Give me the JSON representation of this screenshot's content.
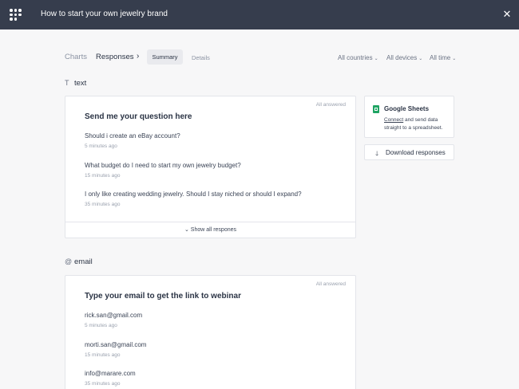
{
  "window": {
    "title": "How to start your own jewelry brand"
  },
  "nav": {
    "charts": "Charts",
    "responses": "Responses",
    "arrow": "›",
    "summary": "Summary",
    "details": "Details",
    "filters": {
      "countries": "All countries",
      "devices": "All devices",
      "time": "All time"
    }
  },
  "sections": [
    {
      "type_label": "text",
      "type_symbol": "T",
      "status": "All answered",
      "question": "Send me your question here",
      "responses": [
        {
          "text": "Should i create an eBay account?",
          "ago": "5 minutes ago"
        },
        {
          "text": "What budget do I need to start my own jewelry budget?",
          "ago": "15 minutes ago"
        },
        {
          "text": "I only like creating wedding jewelry. Should I stay niched or should I expand?",
          "ago": "35 minutes ago"
        }
      ],
      "show_all": "Show all respones"
    },
    {
      "type_label": "email",
      "type_symbol": "@",
      "status": "All answered",
      "question": "Type your email to get the link to webinar",
      "responses": [
        {
          "text": "rick.san@gmail.com",
          "ago": "5 minutes ago"
        },
        {
          "text": "morti.san@gmail.com",
          "ago": "15 minutes ago"
        },
        {
          "text": "info@marare.com",
          "ago": "35 minutes ago"
        }
      ]
    }
  ],
  "sidebar": {
    "sheets": {
      "title": "Google Sheets",
      "link": "Connect",
      "desc": " and send data straight to a spreadsheet."
    },
    "download": {
      "label": "Download responses"
    }
  },
  "colors": {
    "topbar": "#363d4d",
    "sheets_green": "#1fa463",
    "page_bg": "#f7f7f8"
  }
}
